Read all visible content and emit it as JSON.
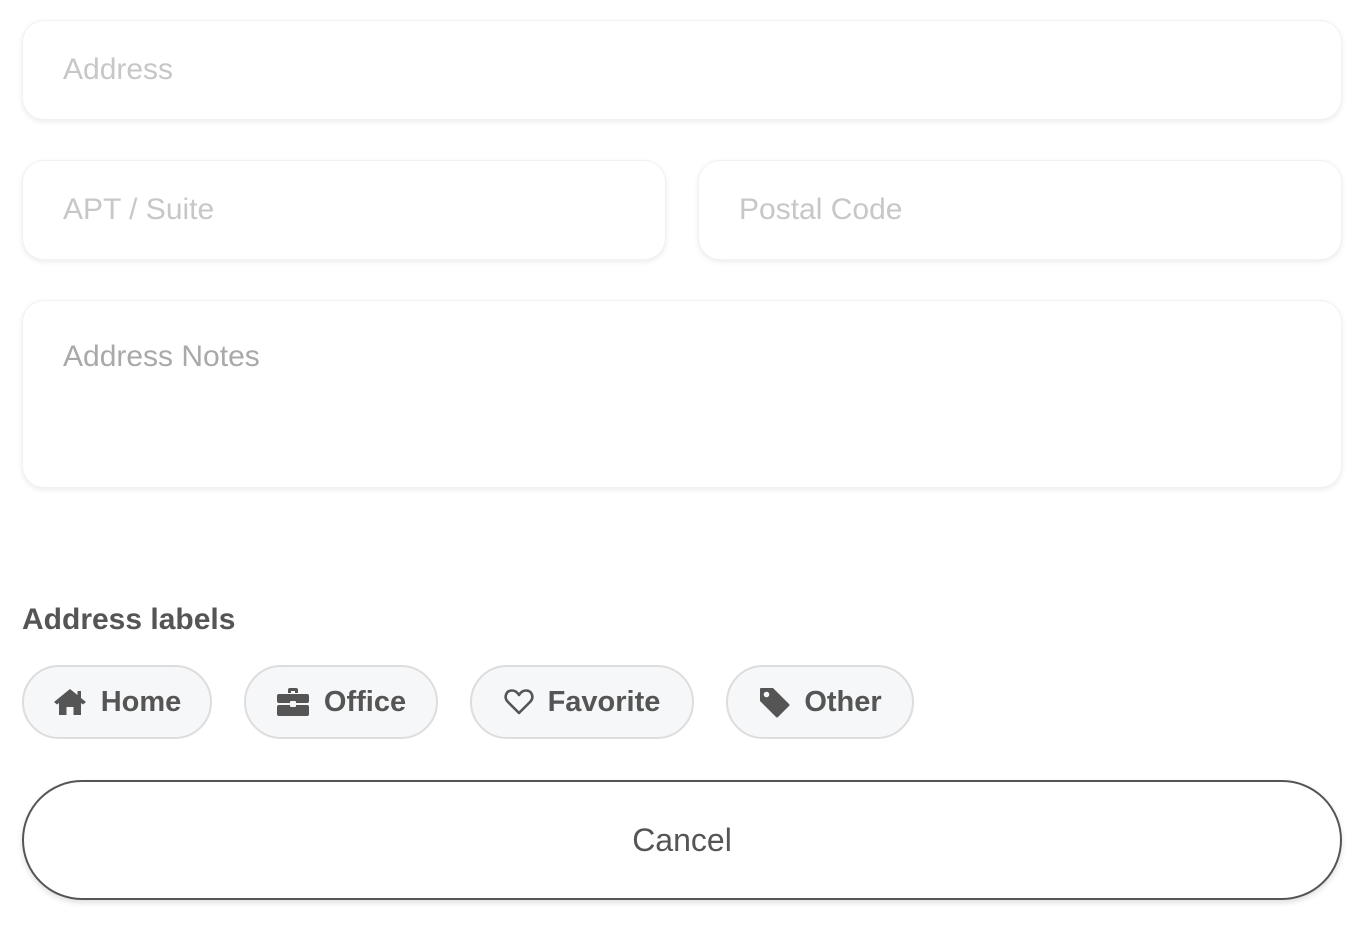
{
  "form": {
    "address": {
      "value": "",
      "placeholder": "Address"
    },
    "apt": {
      "value": "",
      "placeholder": "APT / Suite"
    },
    "postal": {
      "value": "",
      "placeholder": "Postal Code"
    },
    "notes": {
      "value": "",
      "placeholder": "Address Notes"
    }
  },
  "labels": {
    "heading": "Address labels",
    "options": [
      {
        "label": "Home",
        "icon": "home-icon"
      },
      {
        "label": "Office",
        "icon": "briefcase-icon"
      },
      {
        "label": "Favorite",
        "icon": "heart-icon"
      },
      {
        "label": "Other",
        "icon": "tag-icon"
      }
    ]
  },
  "actions": {
    "cancel_label": "Cancel"
  },
  "colors": {
    "text": "#555555",
    "placeholder": "#c7c7c7",
    "chip_bg": "#f6f7f9",
    "chip_border": "#dddddd"
  }
}
